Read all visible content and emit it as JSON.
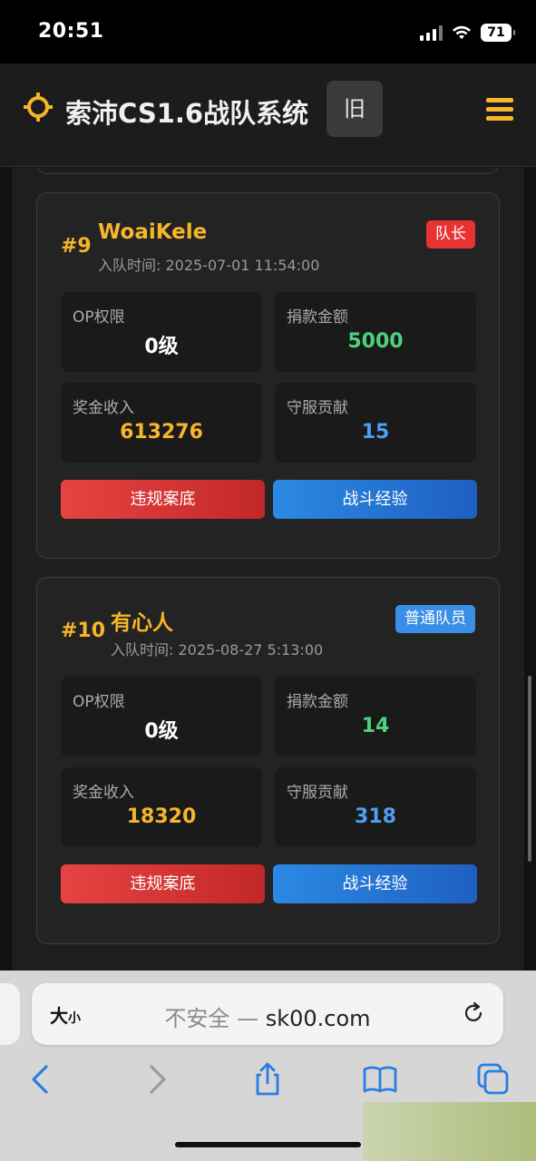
{
  "status_bar": {
    "time": "20:51",
    "battery": "71"
  },
  "header": {
    "title": "索沛CS1.6战队系统",
    "old_button": "旧"
  },
  "cards": [
    {
      "rank": "#9",
      "name": "WoaiKele",
      "join_time": "入队时间: 2025-07-01 11:54:00",
      "role": "队长",
      "role_color": "#e83333",
      "stats": [
        {
          "label": "OP权限",
          "value": "0级",
          "color": "#ffffff"
        },
        {
          "label": "捐款金额",
          "value": "5000",
          "color": "#4cd37b"
        },
        {
          "label": "奖金收入",
          "value": "613276",
          "color": "#f5b62a"
        },
        {
          "label": "守服贡献",
          "value": "15",
          "color": "#4f9ef0"
        }
      ],
      "violation_button": "违规案底",
      "battle_button": "战斗经验"
    },
    {
      "rank": "#10",
      "name": "有心人",
      "join_time": "入队时间: 2025-08-27 5:13:00",
      "role": "普通队员",
      "role_color": "#3a8ee6",
      "stats": [
        {
          "label": "OP权限",
          "value": "0级",
          "color": "#ffffff"
        },
        {
          "label": "捐款金额",
          "value": "14",
          "color": "#4cd37b"
        },
        {
          "label": "奖金收入",
          "value": "18320",
          "color": "#f5b62a"
        },
        {
          "label": "守服贡献",
          "value": "318",
          "color": "#4f9ef0"
        }
      ],
      "violation_button": "违规案底",
      "battle_button": "战斗经验"
    }
  ],
  "browser": {
    "text_size_big": "大",
    "text_size_small": "小",
    "insecure_label": "不安全 —",
    "domain": "sk00.com"
  },
  "icons": [
    "crosshair-logo-icon",
    "menu-icon",
    "reload-icon",
    "back-icon",
    "forward-icon",
    "share-icon",
    "bookmarks-icon",
    "tabs-icon"
  ]
}
